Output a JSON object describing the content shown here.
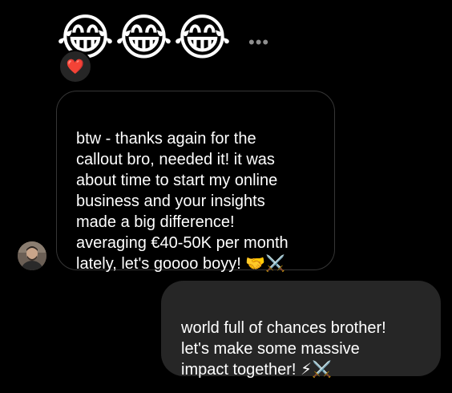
{
  "reaction_emojis": [
    "😂",
    "😂",
    "😂"
  ],
  "more_menu": "•••",
  "reaction": {
    "emoji": "❤️",
    "icon": "red-heart-icon"
  },
  "incoming_message": {
    "text": "btw - thanks again for the\ncallout bro, needed it! it was\nabout time to start my online\nbusiness and your insights\nmade a big difference!\naveraging €40-50K per month\nlately, let's goooo boyy! 🤝⚔️"
  },
  "outgoing_message": {
    "text": "world full of chances brother!\nlet's make some massive\nimpact together! ⚡⚔️"
  },
  "colors": {
    "background": "#000000",
    "incoming_border": "#363636",
    "outgoing_fill": "#262626",
    "text": "#ffffff"
  }
}
